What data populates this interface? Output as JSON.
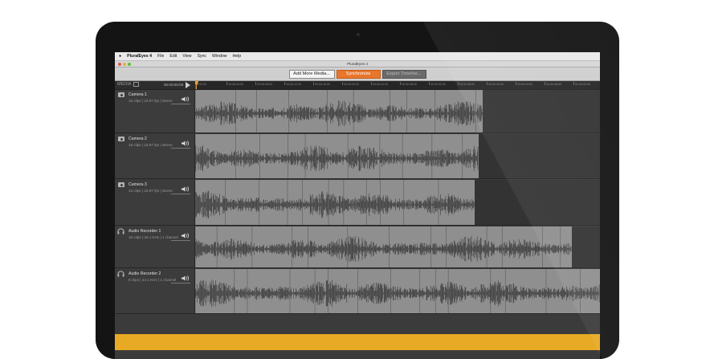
{
  "menu": {
    "apple": "",
    "app_name": "PluralEyes 4",
    "items": [
      "File",
      "Edit",
      "View",
      "Sync",
      "Window",
      "Help"
    ]
  },
  "window_title": "PluralEyes 4",
  "toolbar": {
    "add_media_label": "Add More Media...",
    "sync_label": "Synchronize",
    "export_label": "Export Timeline..."
  },
  "header": {
    "media_label": "MEDIA",
    "timecode": "00:00:00:00",
    "ruler_ticks": [
      "00:00",
      "00:00:04:00",
      "00:00:08:00",
      "00:00:12:00",
      "00:00:16:00",
      "00:00:20:00",
      "00:00:24:00",
      "00:00:28:00",
      "00:00:32:00",
      "00:00:36:00",
      "00:00:40:00",
      "00:00:44:00",
      "00:00:48:00",
      "00:00:52:00"
    ]
  },
  "tracks": [
    {
      "name": "Camera 1",
      "meta": "15 clips  |  23.97 fps  |  stereo",
      "icon": "camera-icon",
      "extent": 0.71
    },
    {
      "name": "Camera 2",
      "meta": "18 clips  |  23.97 fps  |  stereo",
      "icon": "camera-icon",
      "extent": 0.7
    },
    {
      "name": "Camera 3",
      "meta": "13 clips  |  23.97 fps  |  stereo",
      "icon": "camera-icon",
      "extent": 0.69
    },
    {
      "name": "Audio Recorder 1",
      "meta": "16 clips  |  44.1 KHz  |  1 channel",
      "icon": "headphones-icon",
      "extent": 0.93
    },
    {
      "name": "Audio Recorder 2",
      "meta": "8 clips  |  44.1 KHz  |  1 channel",
      "icon": "headphones-icon",
      "extent": 1.0
    }
  ],
  "colors": {
    "accent_orange": "#e8762c",
    "waveform": "#3a3a3a",
    "clip": "#8f8f8f",
    "status_bar": "#e8a924"
  },
  "status_text": ""
}
